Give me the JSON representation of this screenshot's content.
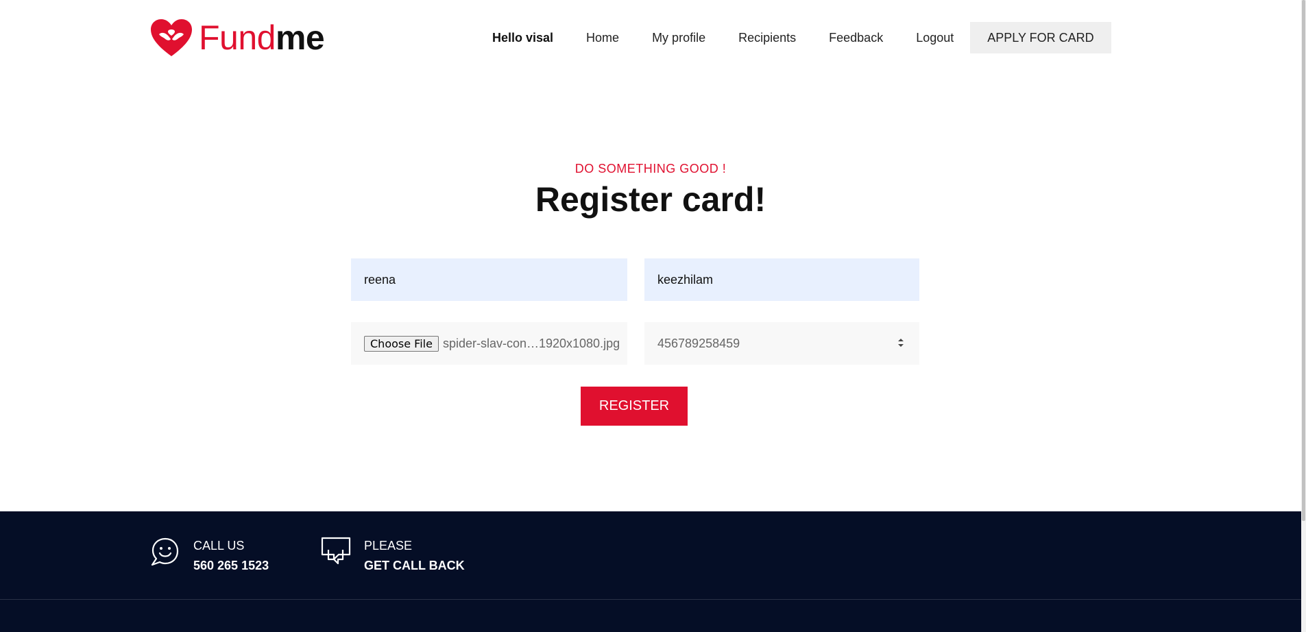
{
  "brand": {
    "logo_part1": "Fund",
    "logo_part2": "me",
    "color": "#e0102f"
  },
  "nav": {
    "greeting": "Hello visal",
    "items": [
      "Home",
      "My profile",
      "Recipients",
      "Feedback",
      "Logout"
    ],
    "apply_label": "APPLY FOR CARD"
  },
  "main": {
    "eyebrow": "DO SOMETHING GOOD !",
    "title": "Register card!",
    "first_name_value": "reena",
    "last_name_value": "keezhilam",
    "file_button_label": "Choose File",
    "file_name": "spider-slav-con…1920x1080.jpg",
    "card_number_value": "456789258459",
    "register_label": "REGISTER"
  },
  "footer": {
    "call_label": "CALL US",
    "call_number": "560 265 1523",
    "callback_label1": "PLEASE",
    "callback_label2": "GET CALL BACK",
    "background": "#050e26"
  },
  "icons": {
    "logo": "heart-hands-icon",
    "call": "smiley-chat-icon",
    "callback": "chat-bubbles-icon",
    "spinner": "number-spinner-icon"
  }
}
